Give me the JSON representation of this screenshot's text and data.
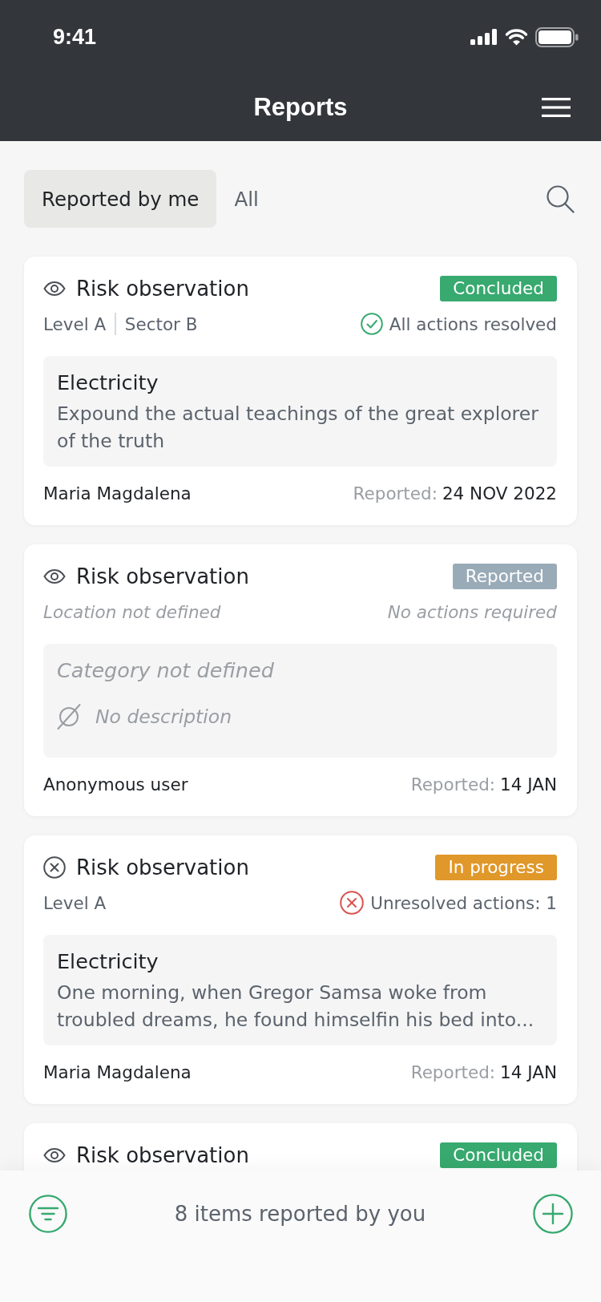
{
  "status_bar": {
    "time": "9:41"
  },
  "header": {
    "title": "Reports"
  },
  "tabs": [
    {
      "label": "Reported by me",
      "selected": true
    },
    {
      "label": "All",
      "selected": false
    }
  ],
  "reports": [
    {
      "kind": "watched",
      "title": "Risk observation",
      "status": {
        "label": "Concluded",
        "color": "#38a96f"
      },
      "location": {
        "defined": true,
        "parts": [
          "Level A",
          "Sector B"
        ]
      },
      "actions": {
        "kind": "resolved",
        "text": "All actions resolved"
      },
      "category": {
        "defined": true,
        "text": "Electricity"
      },
      "description": {
        "defined": true,
        "text": "Expound the actual teachings of the great explorer of the truth"
      },
      "reporter": "Maria Magdalena",
      "reported_label": "Reported:",
      "reported_date": "24 NOV 2022"
    },
    {
      "kind": "watched",
      "title": "Risk observation",
      "status": {
        "label": "Reported",
        "color": "#9aabb8"
      },
      "location": {
        "defined": false,
        "parts": [
          "Location not defined"
        ]
      },
      "actions": {
        "kind": "none",
        "text": "No actions required"
      },
      "category": {
        "defined": false,
        "text": "Category not defined"
      },
      "description": {
        "defined": false,
        "text": "No description"
      },
      "reporter": "Anonymous user",
      "reported_label": "Reported:",
      "reported_date": "14 JAN"
    },
    {
      "kind": "closed",
      "title": "Risk observation",
      "status": {
        "label": "In progress",
        "color": "#e0982a"
      },
      "location": {
        "defined": true,
        "parts": [
          "Level A"
        ]
      },
      "actions": {
        "kind": "unresolved",
        "text": "Unresolved actions: 1"
      },
      "category": {
        "defined": true,
        "text": "Electricity"
      },
      "description": {
        "defined": true,
        "text": "One morning, when Gregor Samsa woke from troubled dreams, he found himselfin his bed into..."
      },
      "reporter": "Maria Magdalena",
      "reported_label": "Reported:",
      "reported_date": "14 JAN"
    },
    {
      "kind": "watched",
      "title": "Risk observation",
      "status": {
        "label": "Concluded",
        "color": "#38a96f"
      }
    }
  ],
  "bottom_bar": {
    "summary": "8 items reported by you"
  }
}
